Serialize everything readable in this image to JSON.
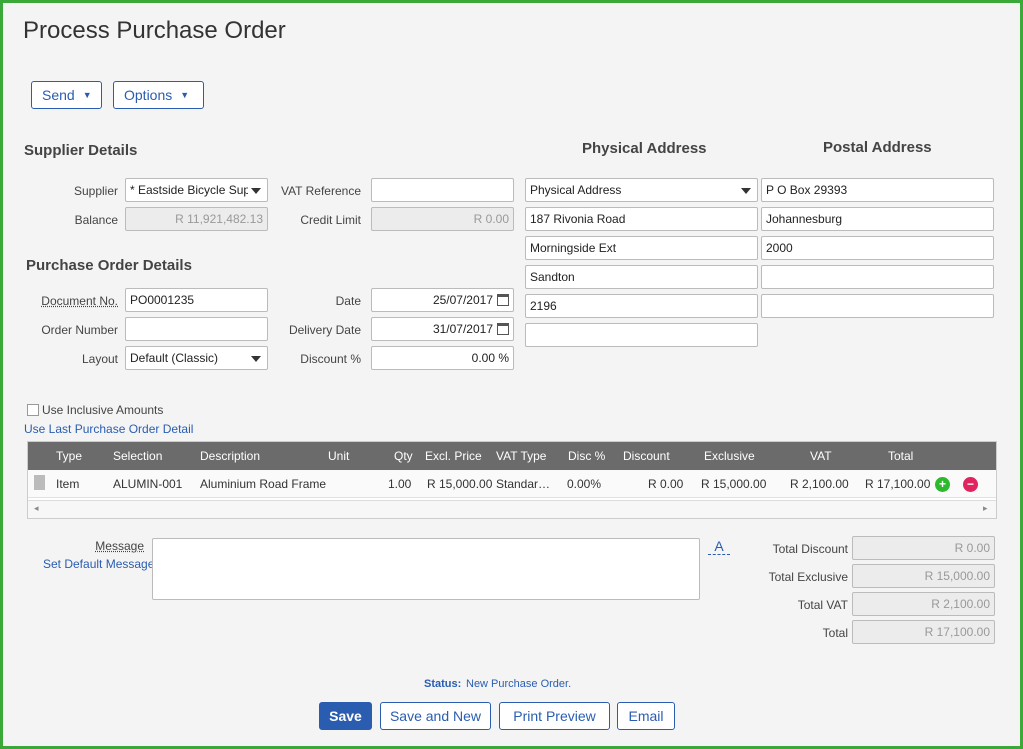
{
  "page": {
    "title": "Process Purchase Order"
  },
  "toolbar": {
    "send_label": "Send",
    "options_label": "Options"
  },
  "supplier": {
    "section_title": "Supplier Details",
    "supplier_label": "Supplier",
    "supplier_value": "* Eastside Bicycle Supplies",
    "balance_label": "Balance",
    "balance_value": "R 11,921,482.13",
    "vat_ref_label": "VAT Reference",
    "vat_ref_value": "",
    "credit_limit_label": "Credit Limit",
    "credit_limit_value": "R 0.00"
  },
  "physical": {
    "title": "Physical Address",
    "select_value": "Physical Address",
    "line1": "187 Rivonia Road",
    "line2": "Morningside Ext",
    "line3": "Sandton",
    "line4": "2196",
    "line5": ""
  },
  "postal": {
    "title": "Postal Address",
    "line1": "P O Box 29393",
    "line2": "Johannesburg",
    "line3": "2000",
    "line4": "",
    "line5": ""
  },
  "po": {
    "section_title": "Purchase Order Details",
    "doc_no_label": "Document No.",
    "doc_no_value": "PO0001235",
    "order_number_label": "Order Number",
    "order_number_value": "",
    "layout_label": "Layout",
    "layout_value": "Default (Classic)",
    "date_label": "Date",
    "date_value": "25/07/2017",
    "delivery_label": "Delivery Date",
    "delivery_value": "31/07/2017",
    "discount_label": "Discount %",
    "discount_value": "0.00 %"
  },
  "options": {
    "inclusive_label": "Use Inclusive Amounts",
    "last_detail_link": "Use Last Purchase Order Detail"
  },
  "grid": {
    "headers": [
      "Type",
      "Selection",
      "Description",
      "Unit",
      "Qty",
      "Excl. Price",
      "VAT Type",
      "Disc %",
      "Discount",
      "Exclusive",
      "VAT",
      "Total"
    ],
    "rows": [
      {
        "type": "Item",
        "selection": "ALUMIN-001",
        "description": "Aluminium Road Frame",
        "unit": "",
        "qty": "1.00",
        "excl_price": "R 15,000.00",
        "vat_type": "Standar…",
        "disc_pct": "0.00%",
        "discount": "R 0.00",
        "exclusive": "R 15,000.00",
        "vat": "R 2,100.00",
        "total": "R 17,100.00"
      }
    ]
  },
  "message": {
    "label": "Message",
    "set_default_link": "Set Default Message",
    "format_glyph": "A"
  },
  "totals": {
    "discount_label": "Total Discount",
    "discount_value": "R 0.00",
    "exclusive_label": "Total Exclusive",
    "exclusive_value": "R 15,000.00",
    "vat_label": "Total VAT",
    "vat_value": "R 2,100.00",
    "total_label": "Total",
    "total_value": "R 17,100.00"
  },
  "status": {
    "label": "Status:",
    "value": "New Purchase Order."
  },
  "actions": {
    "save": "Save",
    "save_new": "Save and New",
    "print_preview": "Print Preview",
    "email": "Email"
  },
  "colors": {
    "accent": "#2a5db0",
    "frame": "#3aa93a",
    "add": "#2eb82e",
    "remove": "#e0245e"
  }
}
